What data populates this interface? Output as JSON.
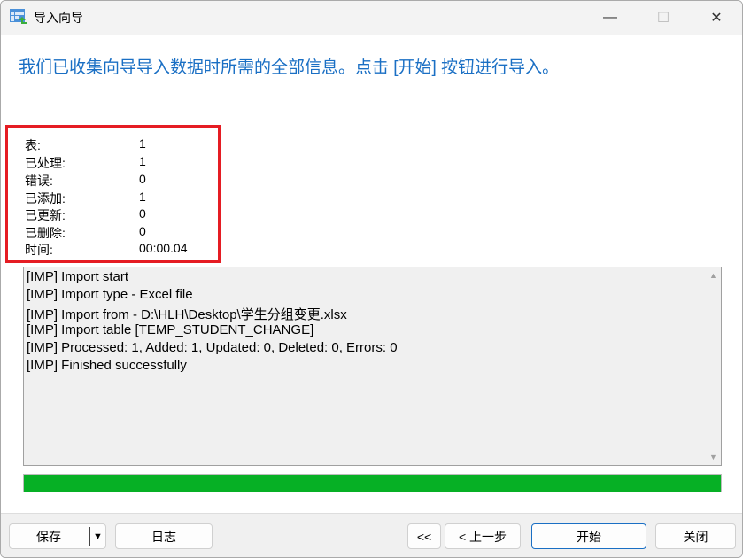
{
  "window": {
    "title": "导入向导",
    "minimize": "—",
    "maximize": "☐",
    "close": "✕"
  },
  "heading": "我们已收集向导导入数据时所需的全部信息。点击 [开始] 按钮进行导入。",
  "stats": [
    {
      "label": "表:",
      "value": "1"
    },
    {
      "label": "已处理:",
      "value": "1"
    },
    {
      "label": "错误:",
      "value": "0"
    },
    {
      "label": "已添加:",
      "value": "1"
    },
    {
      "label": "已更新:",
      "value": "0"
    },
    {
      "label": "已删除:",
      "value": "0"
    },
    {
      "label": "时间:",
      "value": "00:00.04"
    }
  ],
  "log": [
    "[IMP] Import start",
    "[IMP] Import type - Excel file",
    "[IMP] Import from - D:\\HLH\\Desktop\\学生分组变更.xlsx",
    "[IMP] Import table [TEMP_STUDENT_CHANGE]",
    "[IMP] Processed: 1, Added: 1, Updated: 0, Deleted: 0, Errors: 0",
    "[IMP] Finished successfully"
  ],
  "progress_percent": 100,
  "colors": {
    "accent": "#1a6fc4",
    "progress": "#06b025",
    "highlight": "#e51c23"
  },
  "buttons": {
    "save": "保存",
    "log": "日志",
    "first": "<<",
    "prev": "< 上一步",
    "start": "开始",
    "close": "关闭"
  }
}
